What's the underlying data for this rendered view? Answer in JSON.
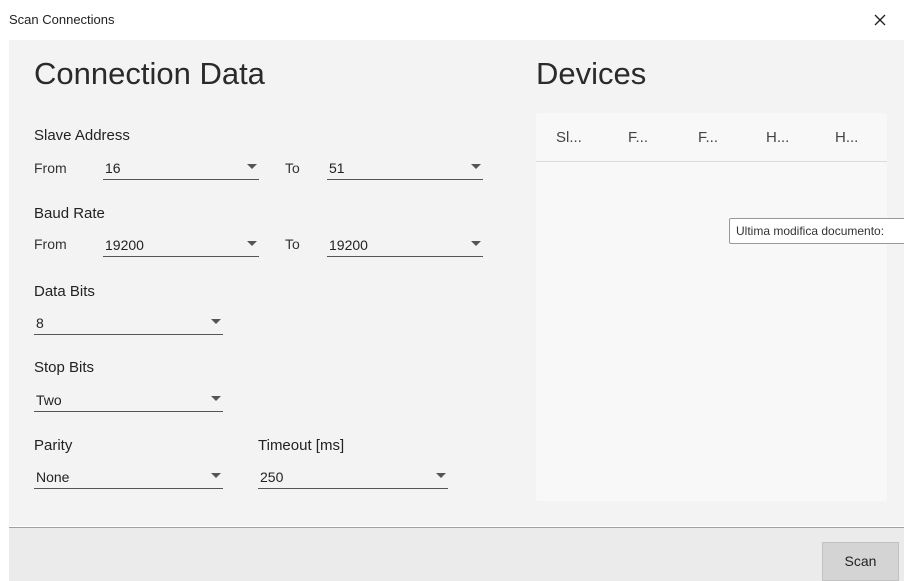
{
  "window": {
    "title": "Scan Connections",
    "close_icon": "close-icon"
  },
  "connection": {
    "heading": "Connection Data",
    "slave_address": {
      "label": "Slave Address",
      "from_label": "From",
      "from_value": "16",
      "to_label": "To",
      "to_value": "51"
    },
    "baud_rate": {
      "label": "Baud Rate",
      "from_label": "From",
      "from_value": "19200",
      "to_label": "To",
      "to_value": "19200"
    },
    "data_bits": {
      "label": "Data Bits",
      "value": "8"
    },
    "stop_bits": {
      "label": "Stop Bits",
      "value": "Two"
    },
    "parity": {
      "label": "Parity",
      "value": "None"
    },
    "timeout": {
      "label": "Timeout [ms]",
      "value": "250"
    }
  },
  "devices": {
    "heading": "Devices",
    "columns": [
      "Sl...",
      "F...",
      "F...",
      "H...",
      "H..."
    ]
  },
  "tooltip": {
    "text": "Ultima modifica documento:"
  },
  "footer": {
    "scan_label": "Scan"
  }
}
